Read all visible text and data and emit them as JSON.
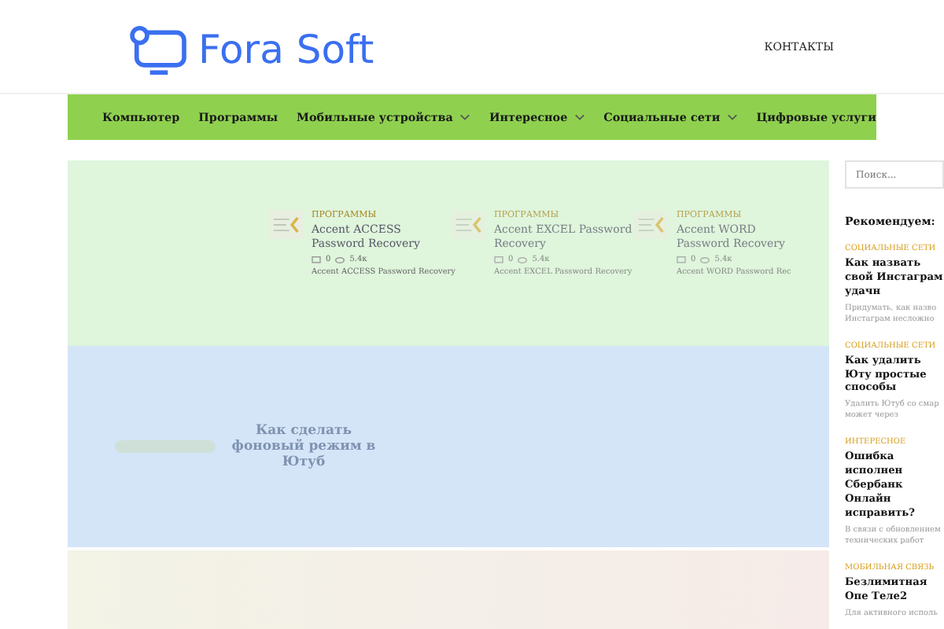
{
  "header": {
    "logo_text": "Fora Soft",
    "contacts_link": "КОНТАКТЫ"
  },
  "nav": [
    {
      "label": "Компьютер",
      "has_dropdown": false
    },
    {
      "label": "Программы",
      "has_dropdown": false
    },
    {
      "label": "Мобильные устройства",
      "has_dropdown": true
    },
    {
      "label": "Интересное",
      "has_dropdown": true
    },
    {
      "label": "Социальные сети",
      "has_dropdown": true
    },
    {
      "label": "Цифровые услуги",
      "has_dropdown": false
    }
  ],
  "slider_cards": [
    {
      "category": "ПРОГРАММЫ",
      "title": "Accent ACCESS Password Recovery",
      "comments": "0",
      "views": "5.4к",
      "excerpt": "Accent ACCESS Password Recovery",
      "faded": false
    },
    {
      "category": "ПРОГРАММЫ",
      "title": "Accent EXCEL Password Recovery",
      "comments": "0",
      "views": "5.4к",
      "excerpt": "Accent EXCEL Password Recovery",
      "faded": true
    },
    {
      "category": "ПРОГРАММЫ",
      "title": "Accent WORD Password Recovery",
      "comments": "0",
      "views": "5.4к",
      "excerpt": "Accent WORD Password Rec",
      "faded": true
    }
  ],
  "feature": {
    "title": "Как сделать фоновый режим в Ютуб"
  },
  "sidebar": {
    "search": {
      "placeholder": "Поиск..."
    },
    "heading": "Рекомендуем:",
    "posts": [
      {
        "category": "СОЦИАЛЬНЫЕ СЕТИ",
        "title": "Как назвать свой Инстаграм удачн",
        "excerpt": "Придумать, как назво Инстаграм несложно"
      },
      {
        "category": "СОЦИАЛЬНЫЕ СЕТИ",
        "title": "Как удалить Юту простые способы",
        "excerpt": "Удалить Ютуб со смар может через"
      },
      {
        "category": "ИНТЕРЕСНОЕ",
        "title": "Ошибка исполнен Сбербанк Онлайн исправить?",
        "excerpt": "В связи с обновлением технических работ"
      },
      {
        "category": "МОБИЛЬНАЯ СВЯЗЬ",
        "title": "Безлимитная Опе Теле2",
        "excerpt": "Для активного исполь"
      }
    ]
  }
}
